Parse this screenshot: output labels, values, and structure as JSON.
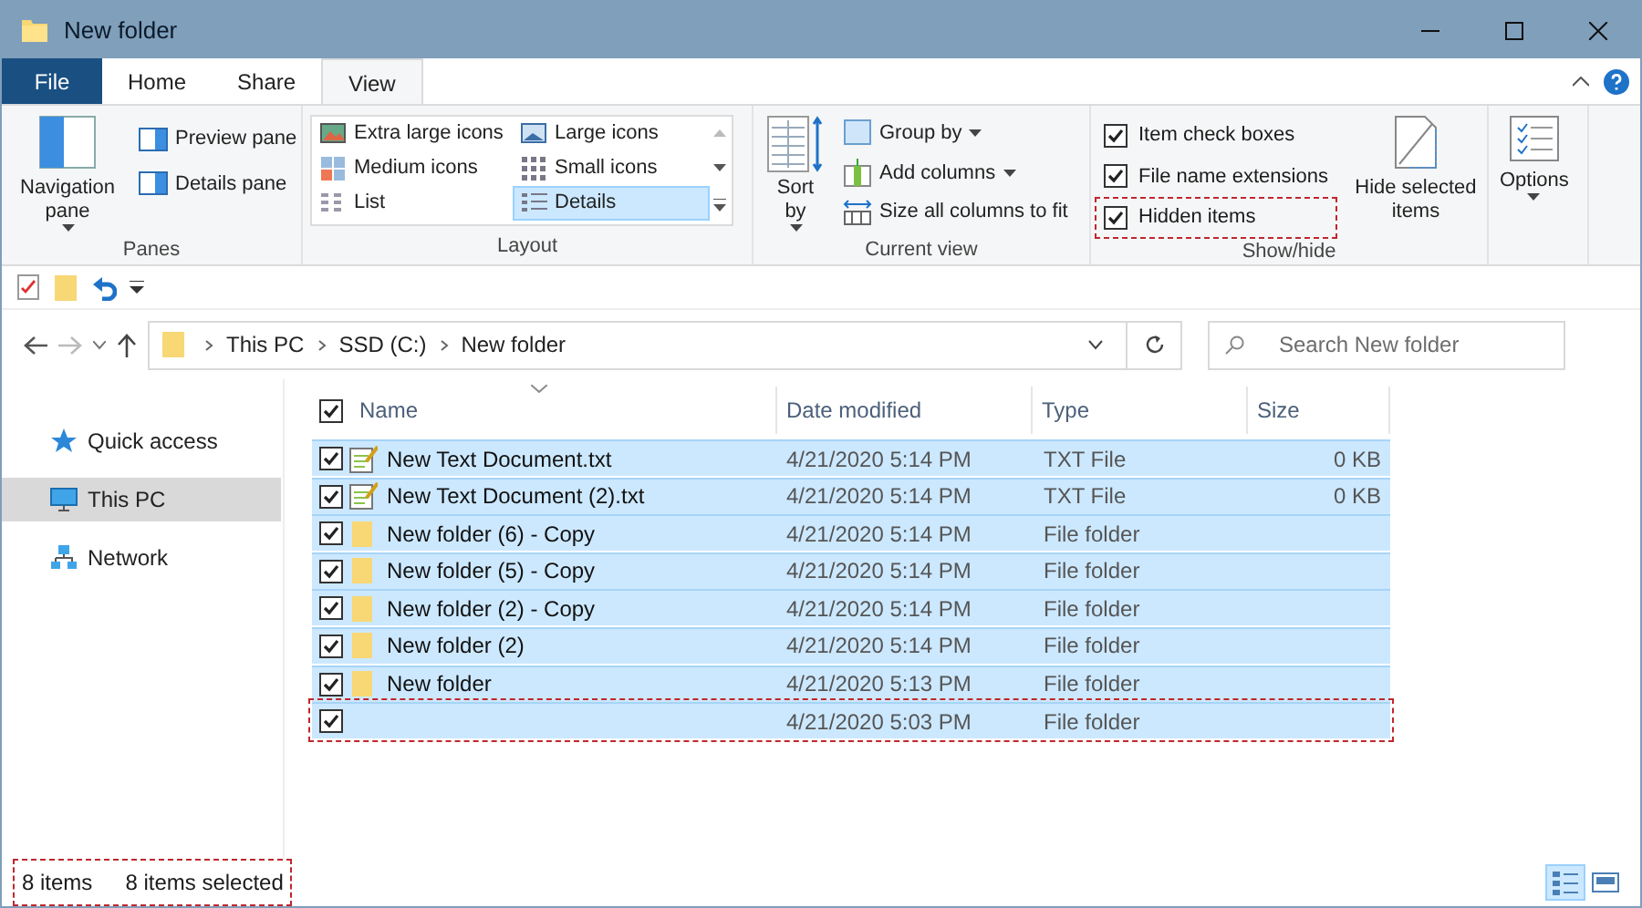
{
  "window": {
    "title": "New folder"
  },
  "tabs": [
    {
      "label": "File",
      "kind": "file",
      "selected": false
    },
    {
      "label": "Home",
      "kind": "tab",
      "selected": false
    },
    {
      "label": "Share",
      "kind": "tab",
      "selected": false
    },
    {
      "label": "View",
      "kind": "tab",
      "selected": true
    }
  ],
  "panes": {
    "label": "Panes",
    "navigation_pane": "Navigation pane",
    "items": [
      "Preview pane",
      "Details pane"
    ]
  },
  "layout": {
    "label": "Layout",
    "options": [
      {
        "label": "Extra large icons",
        "selected": false
      },
      {
        "label": "Large icons",
        "selected": false
      },
      {
        "label": "Medium icons",
        "selected": false
      },
      {
        "label": "Small icons",
        "selected": false
      },
      {
        "label": "List",
        "selected": false
      },
      {
        "label": "Details",
        "selected": true
      }
    ]
  },
  "current_view": {
    "label": "Current view",
    "sort_by": "Sort by",
    "items": [
      {
        "label": "Group by",
        "dropdown": true
      },
      {
        "label": "Add columns",
        "dropdown": true
      },
      {
        "label": "Size all columns to fit",
        "dropdown": false
      }
    ]
  },
  "show_hide": {
    "label": "Show/hide",
    "checkboxes": [
      {
        "label": "Item check boxes",
        "checked": true,
        "highlighted": false
      },
      {
        "label": "File name extensions",
        "checked": true,
        "highlighted": false
      },
      {
        "label": "Hidden items",
        "checked": true,
        "highlighted": true
      }
    ],
    "hide_selected": "Hide selected items"
  },
  "options": {
    "label": "Options"
  },
  "address": {
    "breadcrumbs": [
      "This PC",
      "SSD (C:)",
      "New folder"
    ]
  },
  "search": {
    "placeholder": "Search New folder"
  },
  "navigation": [
    {
      "label": "Quick access",
      "kind": "star",
      "selected": false
    },
    {
      "label": "This PC",
      "kind": "pc",
      "selected": true
    },
    {
      "label": "Network",
      "kind": "network",
      "selected": false
    }
  ],
  "table": {
    "all_checked": true,
    "columns": [
      "Name",
      "Date modified",
      "Type",
      "Size"
    ],
    "rows": [
      {
        "kind": "text",
        "name": "New Text Document.txt",
        "date": "4/21/2020 5:14 PM",
        "type": "TXT File",
        "size": "0 KB",
        "checked": true,
        "selected": true,
        "highlighted": false
      },
      {
        "kind": "text",
        "name": "New Text Document (2).txt",
        "date": "4/21/2020 5:14 PM",
        "type": "TXT File",
        "size": "0 KB",
        "checked": true,
        "selected": true,
        "highlighted": false
      },
      {
        "kind": "folder",
        "name": "New folder (6) - Copy",
        "date": "4/21/2020 5:14 PM",
        "type": "File folder",
        "checked": true,
        "selected": true,
        "highlighted": false
      },
      {
        "kind": "folder",
        "name": "New folder (5) - Copy",
        "date": "4/21/2020 5:14 PM",
        "type": "File folder",
        "checked": true,
        "selected": true,
        "highlighted": false
      },
      {
        "kind": "folder",
        "name": "New folder (2) - Copy",
        "date": "4/21/2020 5:14 PM",
        "type": "File folder",
        "checked": true,
        "selected": true,
        "highlighted": false
      },
      {
        "kind": "folder",
        "name": "New folder (2)",
        "date": "4/21/2020 5:14 PM",
        "type": "File folder",
        "checked": true,
        "selected": true,
        "highlighted": false
      },
      {
        "kind": "folder",
        "name": "New folder",
        "date": "4/21/2020 5:13 PM",
        "type": "File folder",
        "checked": true,
        "selected": true,
        "highlighted": false
      },
      {
        "kind": "blank",
        "date": "4/21/2020 5:03 PM",
        "type": "File folder",
        "checked": true,
        "selected": true,
        "highlighted": true
      }
    ]
  },
  "status_bar": {
    "item_count": "8 items",
    "selection": "8 items selected",
    "highlighted": true,
    "views": [
      {
        "kind": "details",
        "selected": true
      },
      {
        "kind": "large",
        "selected": false
      }
    ]
  }
}
